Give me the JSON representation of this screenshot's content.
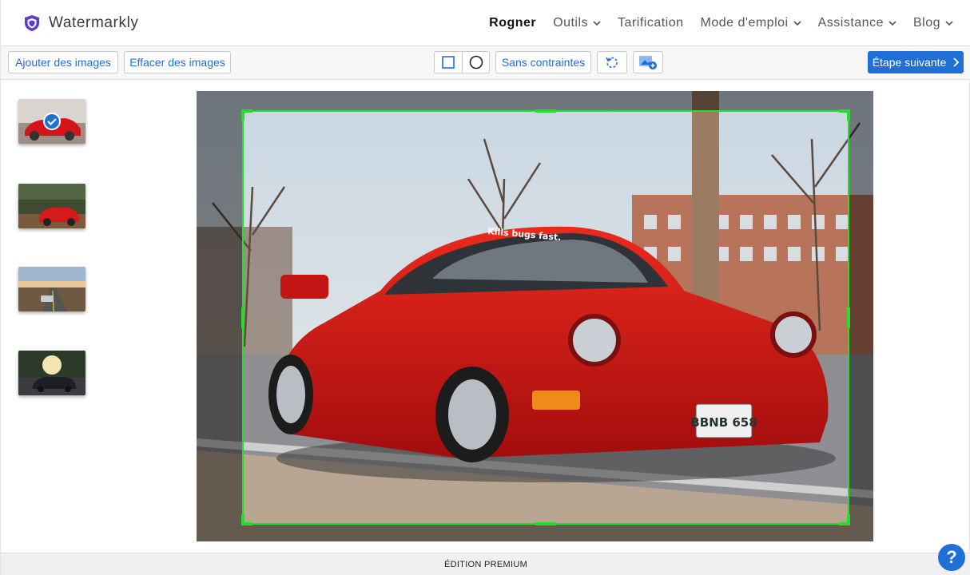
{
  "brand": {
    "name": "Watermarkly",
    "color": "#5a3ec8"
  },
  "nav": {
    "items": [
      {
        "label": "Rogner",
        "active": true,
        "dropdown": false
      },
      {
        "label": "Outils",
        "active": false,
        "dropdown": true
      },
      {
        "label": "Tarification",
        "active": false,
        "dropdown": false
      },
      {
        "label": "Mode d'emploi",
        "active": false,
        "dropdown": true
      },
      {
        "label": "Assistance",
        "active": false,
        "dropdown": true
      },
      {
        "label": "Blog",
        "active": false,
        "dropdown": true
      }
    ]
  },
  "toolbar": {
    "add_images": "Ajouter des images",
    "clear_images": "Effacer des images",
    "shape_rect_icon": "square-icon",
    "shape_circle_icon": "circle-icon",
    "aspect_ratio": "Sans contraintes",
    "rotate_icon": "rotate-icon",
    "add_image_icon": "add-image-icon",
    "next_step": "Étape suivante"
  },
  "thumbnails": [
    {
      "subject": "red sports car",
      "selected": true
    },
    {
      "subject": "red car in forest",
      "selected": false
    },
    {
      "subject": "car on road at sunset",
      "selected": false
    },
    {
      "subject": "car in sunlit park",
      "selected": false
    }
  ],
  "editor": {
    "image_subject": "red classic sports car on street",
    "plate_text": "BBNB 658",
    "windshield_text": "Kills bugs fast.",
    "crop_color": "#22e02a"
  },
  "footer": {
    "label": "ÉDITION PREMIUM"
  },
  "help": {
    "label": "?"
  },
  "colors": {
    "accent": "#1f6fd6",
    "crop": "#22e02a"
  }
}
